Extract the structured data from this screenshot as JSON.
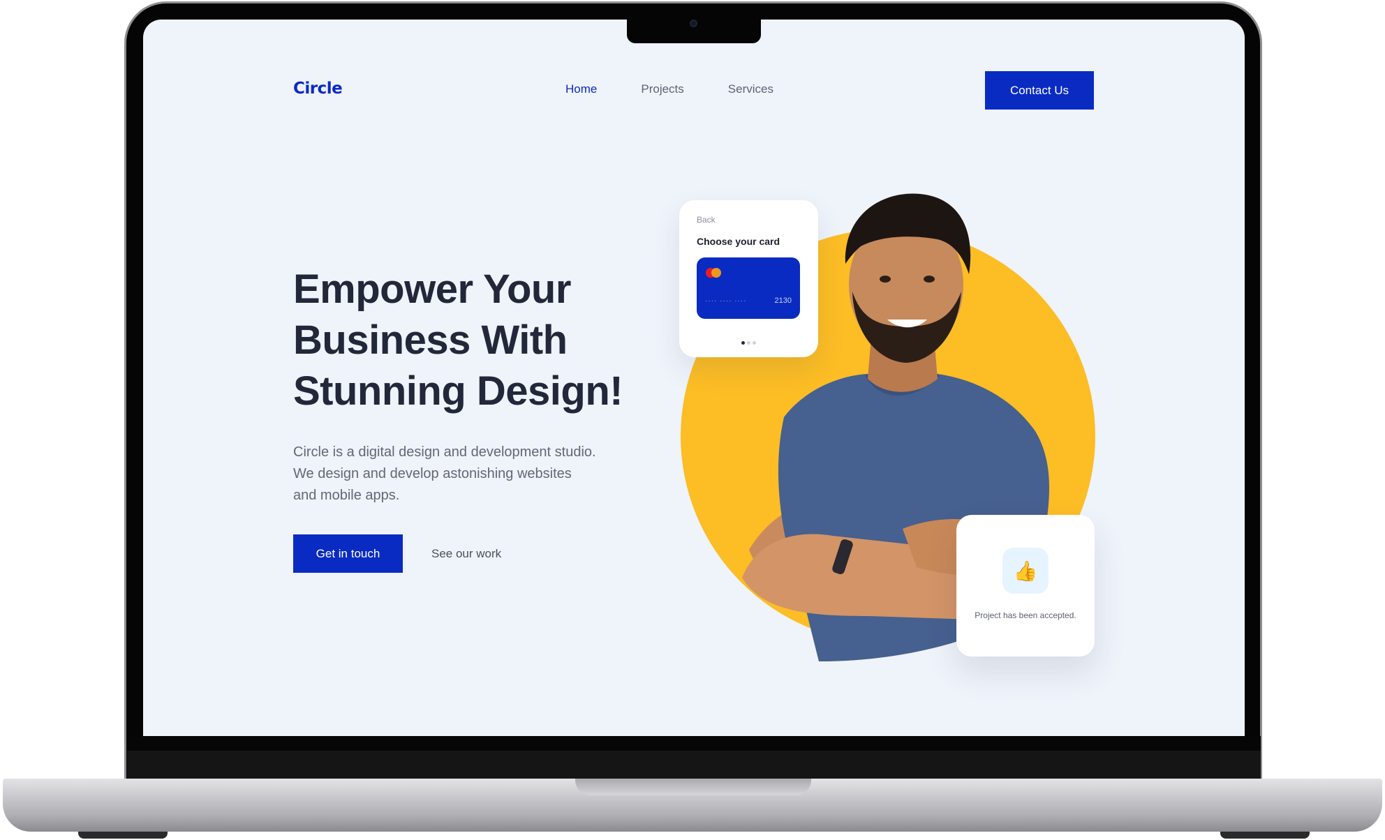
{
  "site": {
    "logo": "Circle",
    "nav": [
      {
        "label": "Home",
        "active": true
      },
      {
        "label": "Projects",
        "active": false
      },
      {
        "label": "Services",
        "active": false
      }
    ],
    "contact_label": "Contact Us"
  },
  "hero": {
    "headline_lines": [
      "Empower Your",
      "Business With",
      "Stunning Design!"
    ],
    "sub_lines": [
      "Circle is a digital design and development studio.",
      "We design and develop astonishing websites",
      "and mobile apps."
    ],
    "primary_cta": "Get in touch",
    "secondary_cta": "See our work"
  },
  "card_widget": {
    "back_label": "Back",
    "title": "Choose your card",
    "masked_digits": "···· ···· ····",
    "last_digits": "2130",
    "pager_count": 3,
    "pager_active": 0
  },
  "accept_widget": {
    "icon": "thumbs-up-icon",
    "message": "Project has been accepted."
  },
  "colors": {
    "brand": "#0a2bc2",
    "accent": "#fcbd25",
    "page_bg": "#eff3fa",
    "heading": "#22273a"
  }
}
